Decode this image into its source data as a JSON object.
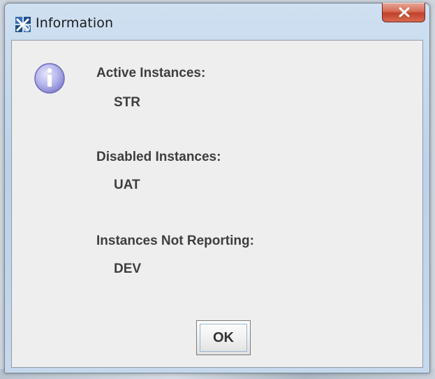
{
  "window": {
    "title": "Information",
    "icons": {
      "app": "app-logo-icon",
      "close": "close-icon"
    }
  },
  "dialog": {
    "icon": "info-icon",
    "sections": [
      {
        "heading": "Active Instances:",
        "value": "STR"
      },
      {
        "heading": "Disabled Instances:",
        "value": "UAT"
      },
      {
        "heading": "Instances Not Reporting:",
        "value": "DEV"
      }
    ],
    "ok_label": "OK"
  },
  "colors": {
    "client_background": "#eeeeee",
    "text": "#3e3e3e",
    "close_button": "#c7452f",
    "info_icon": "#8b8bd6"
  }
}
